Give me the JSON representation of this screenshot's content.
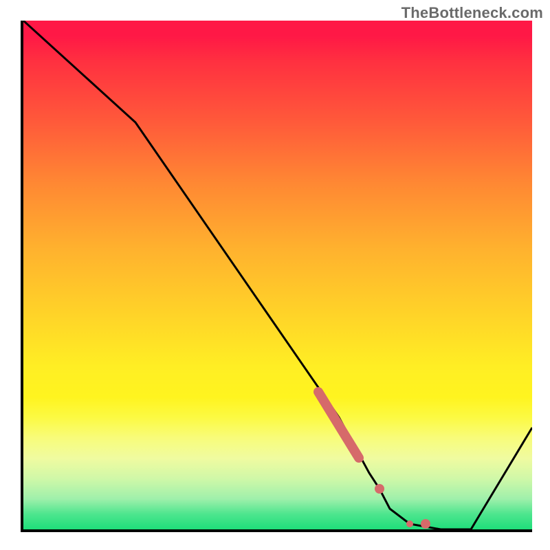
{
  "watermark": "TheBottleneck.com",
  "chart_data": {
    "type": "line",
    "title": "",
    "xlabel": "",
    "ylabel": "",
    "xlim": [
      0,
      100
    ],
    "ylim": [
      0,
      100
    ],
    "series": [
      {
        "name": "curve",
        "x": [
          0,
          22,
          62,
          68,
          70,
          72,
          76,
          82,
          88,
          100
        ],
        "values": [
          100,
          80,
          22,
          11,
          8,
          4,
          1,
          0,
          0,
          20
        ]
      }
    ],
    "markers": [
      {
        "name": "grip-start",
        "x": 58,
        "y": 27,
        "kind": "thick-segment-start"
      },
      {
        "name": "grip-end",
        "x": 66,
        "y": 13,
        "kind": "thick-segment-end"
      },
      {
        "name": "dot-a",
        "x": 70,
        "y": 8,
        "kind": "dot"
      },
      {
        "name": "dot-b",
        "x": 76,
        "y": 1,
        "kind": "dot-small"
      },
      {
        "name": "dot-c",
        "x": 79,
        "y": 1,
        "kind": "dot"
      }
    ],
    "colors": {
      "axis": "#000000",
      "line": "#000000",
      "marker": "#d66a6a"
    }
  }
}
